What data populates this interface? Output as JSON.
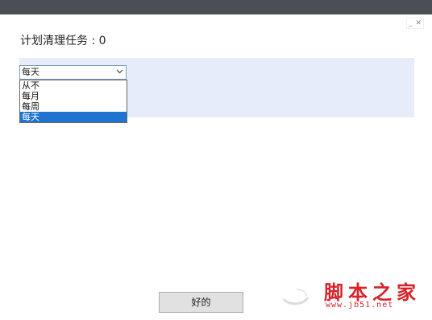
{
  "window": {
    "minimize_glyph": "_",
    "close_glyph": "✕"
  },
  "heading": "计划清理任务 : 0",
  "schedule": {
    "selected": "每天",
    "options": [
      "从不",
      "每月",
      "每周",
      "每天"
    ],
    "highlighted_index": 3
  },
  "ok_label": "好的",
  "watermark": {
    "logo_text": "脚本之家",
    "url_text": "www.jb51.net"
  },
  "colors": {
    "titlebar": "#4b4f55",
    "panel": "#e6ecf9",
    "selection": "#1e74d0",
    "watermark": "#d6232a"
  }
}
